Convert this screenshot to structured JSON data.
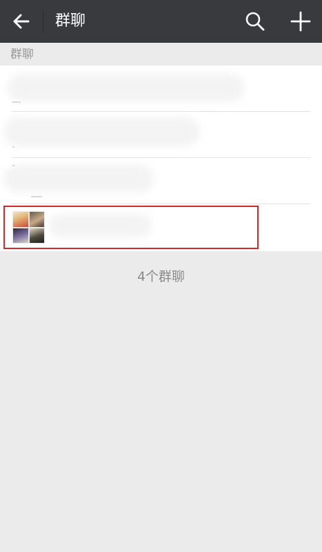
{
  "header": {
    "title": "群聊",
    "back_icon": "arrow-left-icon",
    "search_icon": "search-icon",
    "add_icon": "plus-icon",
    "bar_color": "#393a3e"
  },
  "section": {
    "label": "群聊"
  },
  "groups": [
    {
      "name": ""
    },
    {
      "name": ""
    },
    {
      "name": ""
    },
    {
      "name": "",
      "highlighted": true
    }
  ],
  "footer": {
    "count_text": "4个群聊"
  },
  "colors": {
    "highlight": "#d0282b",
    "background": "#ebebeb"
  }
}
